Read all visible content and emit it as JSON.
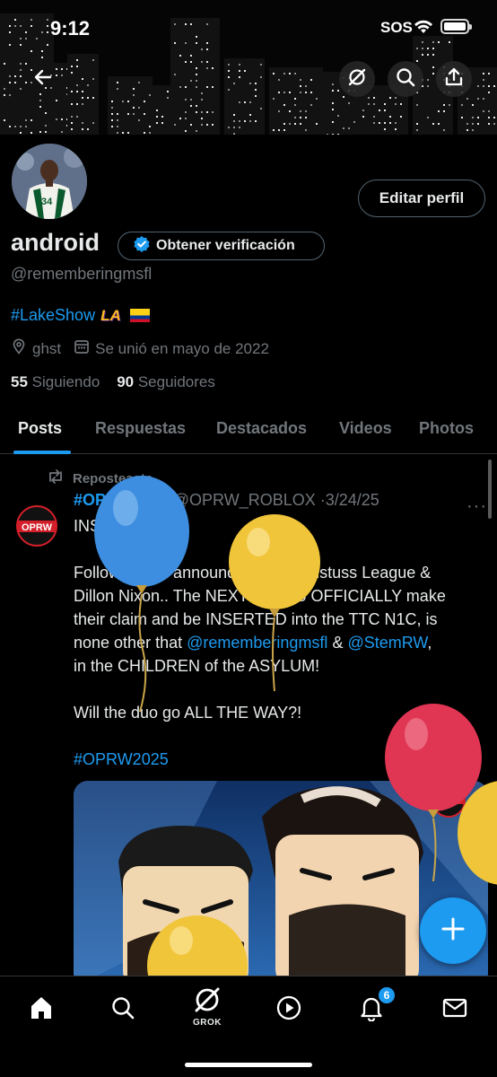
{
  "status_bar": {
    "time": "9:12",
    "sos": "SOS"
  },
  "profile": {
    "display_name": "android",
    "handle": "@rememberingmsfl",
    "verify_label": "Obtener verificación",
    "edit_label": "Editar perfil",
    "bio_hashtag": "#LakeShow",
    "bio_emoji": "LA",
    "location": "ghst",
    "joined": "Se unió en mayo de 2022",
    "following_count": "55",
    "following_label": "Siguiendo",
    "followers_count": "90",
    "followers_label": "Seguidores"
  },
  "tabs": [
    {
      "label": "Posts"
    },
    {
      "label": "Respuestas"
    },
    {
      "label": "Destacados"
    },
    {
      "label": "Videos"
    },
    {
      "label": "Photos"
    }
  ],
  "tweet": {
    "repost_label": "Reposteaste",
    "author": "#OPRW2025",
    "author_handle": "@OPRW_ROBLOX",
    "date": "3/24/25",
    "avatar_text": "OPRW",
    "lines": [
      "INSERTED!",
      "Following the announcement of Justuss League &",
      "Dillon Nixon.. The NEXT team to OFFICIALLY make",
      "their claim and be INSERTED into the TTC N1C, is",
      "none other that",
      "in the CHILDREN of the ASYLUM!",
      "Will the duo go ALL THE WAY?!",
      "#OPRW2025"
    ],
    "mention_1": "@rememberingmsfl",
    "mention_join": " & ",
    "mention_2": "@StemRW",
    "mention_tail": ","
  },
  "nav": {
    "grok_label": "GROK",
    "notifications_badge": "6"
  },
  "colors": {
    "accent": "#1d9bf0",
    "muted": "#71767b",
    "text": "#e7e9ea",
    "border": "#2f3336"
  }
}
